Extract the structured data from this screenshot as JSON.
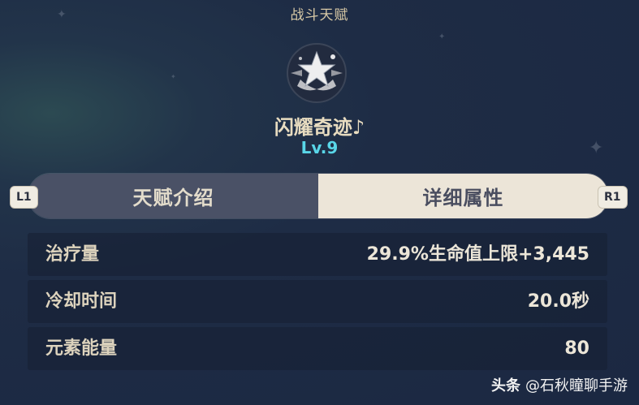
{
  "header": {
    "title": "战斗天赋"
  },
  "talent": {
    "name": "闪耀奇迹♪",
    "level": "Lv.9"
  },
  "tabs": [
    {
      "label": "天赋介绍",
      "active": false
    },
    {
      "label": "详细属性",
      "active": true
    }
  ],
  "bumpers": {
    "left": "L1",
    "right": "R1"
  },
  "stats": [
    {
      "label": "治疗量",
      "value": "29.9%生命值上限+3,445"
    },
    {
      "label": "冷却时间",
      "value": "20.0秒"
    },
    {
      "label": "元素能量",
      "value": "80"
    }
  ],
  "watermark": {
    "logo": "头条",
    "text": "@石秋瞳聊手游"
  },
  "colors": {
    "background": "#1e2c45",
    "accent_level": "#59d6e8",
    "tab_active_bg": "#ece5d8",
    "tab_inactive_bg": "#4a5166",
    "gold_text": "#e8dcc0"
  },
  "icons": [
    "star-burst-talent-icon",
    "sparkle-icon"
  ]
}
